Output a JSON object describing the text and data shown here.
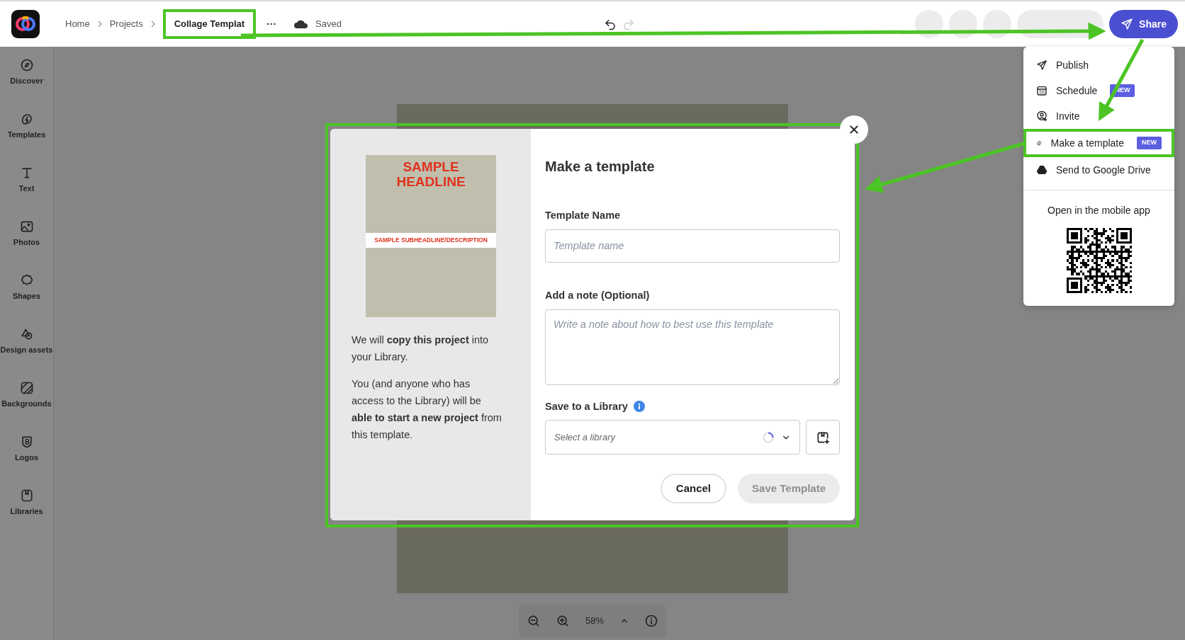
{
  "topbar": {
    "breadcrumbs": [
      {
        "label": "Home",
        "current": false,
        "highlighted": false
      },
      {
        "label": "Projects",
        "current": false,
        "highlighted": false
      },
      {
        "label": "Collage Templat",
        "current": true,
        "highlighted": true
      }
    ],
    "more": "···",
    "status": "Saved",
    "share": "Share"
  },
  "sidebar": {
    "items": [
      {
        "label": "Discover"
      },
      {
        "label": "Templates"
      },
      {
        "label": "Text"
      },
      {
        "label": "Photos"
      },
      {
        "label": "Shapes"
      },
      {
        "label": "Design assets"
      },
      {
        "label": "Backgrounds"
      },
      {
        "label": "Logos"
      },
      {
        "label": "Libraries"
      }
    ]
  },
  "share_menu": {
    "items": [
      {
        "label": "Publish",
        "highlighted": false
      },
      {
        "label": "Schedule",
        "badge": "NEW",
        "highlighted": false
      },
      {
        "label": "Invite",
        "highlighted": false
      },
      {
        "label": "Make a template",
        "badge": "NEW",
        "highlighted": true
      },
      {
        "label": "Send to Google Drive",
        "highlighted": false
      }
    ],
    "mobile_caption": "Open in the mobile app"
  },
  "modal": {
    "highlighted": true,
    "preview": {
      "headline": "SAMPLE HEADLINE",
      "subheadline": "SAMPLE SUBHEADLINE/DESCRIPTION"
    },
    "paragraphs": [
      "We will **copy this project** into your Library.",
      "You (and anyone who has access to the Library) will be **able to start a new project** from this template."
    ],
    "title": "Make a template",
    "fields": [
      {
        "kind": "input",
        "label": "Template Name",
        "placeholder": "Template name"
      },
      {
        "kind": "textarea",
        "label": "Add a note (Optional)",
        "placeholder": "Write a note about how to best use this template"
      },
      {
        "kind": "select",
        "label": "Save to a Library",
        "placeholder": "Select a library",
        "loading": true
      }
    ],
    "buttons": [
      {
        "label": "Cancel",
        "kind": "secondary",
        "disabled": false
      },
      {
        "label": "Save Template",
        "kind": "primary",
        "disabled": true
      }
    ]
  },
  "zoom": {
    "level_text": "58%"
  }
}
